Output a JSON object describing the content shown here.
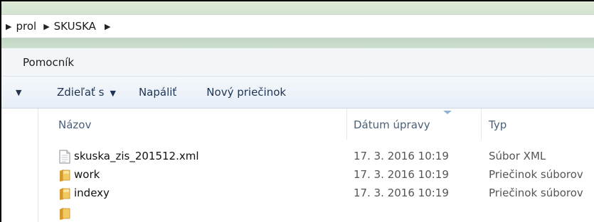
{
  "breadcrumb": {
    "items": [
      "prol",
      "SKUSKA"
    ]
  },
  "menu": {
    "items": [
      "Pomocník"
    ]
  },
  "toolbar": {
    "share_label": "Zdieľať s",
    "burn_label": "Napáliť",
    "new_folder_label": "Nový priečinok"
  },
  "columns": {
    "name": "Názov",
    "date": "Dátum úpravy",
    "type": "Typ"
  },
  "files": [
    {
      "name": "skuska_zis_201512.xml",
      "date": "17. 3. 2016 10:19",
      "type": "Súbor XML",
      "icon": "xml-file-icon"
    },
    {
      "name": "work",
      "date": "17. 3. 2016 10:19",
      "type": "Priečinok súborov",
      "icon": "folder-icon"
    },
    {
      "name": "indexy",
      "date": "17. 3. 2016 10:19",
      "type": "Priečinok súborov",
      "icon": "folder-icon"
    }
  ],
  "colors": {
    "folder": "#e8b64a",
    "header_text": "#4a607a",
    "toolbar_text": "#1e3456",
    "sort_arrow": "#8fb3d6"
  }
}
